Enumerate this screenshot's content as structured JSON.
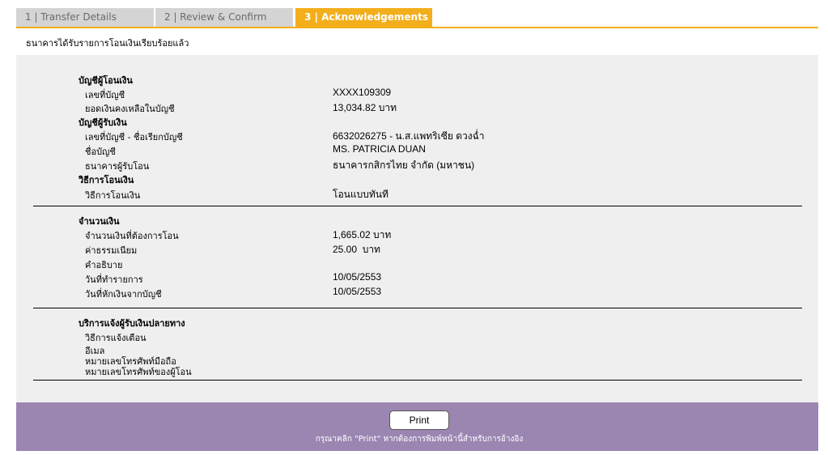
{
  "tabs": [
    {
      "label": "1 | Transfer Details"
    },
    {
      "label": "2 | Review & Confirm"
    },
    {
      "label": "3 | Acknowledgements"
    }
  ],
  "status_message": "ธนาคารได้รับรายการโอนเงินเรียบร้อยแล้ว",
  "from_account": {
    "heading": "บัญชีผู้โอนเงิน",
    "account_no_label": "เลขที่บัญชี",
    "account_no": "XXXX109309",
    "balance_label": "ยอดเงินคงเหลือในบัญชี",
    "balance": "13,034.82 บาท"
  },
  "to_account": {
    "heading": "บัญชีผู้รับเงิน",
    "account_label": "เลขที่บัญชี - ชื่อเรียกบัญชี",
    "account": "6632026275 - น.ส.แพทริเซีย ดวงฉ่ำ",
    "name_label": "ชื่อบัญชี",
    "name": "MS. PATRICIA DUAN",
    "bank_label": "ธนาคารผู้รับโอน",
    "bank": "ธนาคารกสิกรไทย จำกัด (มหาชน)"
  },
  "method": {
    "heading": "วิธีการโอนเงิน",
    "label": "วิธีการโอนเงิน",
    "value": "โอนแบบทันที"
  },
  "amount": {
    "heading": "จำนวนเงิน",
    "amount_label": "จำนวนเงินที่ต้องการโอน",
    "amount": "1,665.02 บาท",
    "fee_label": "ค่าธรรมเนียม",
    "fee": "25.00  บาท",
    "desc_label": "คำอธิบาย",
    "txn_date_label": "วันที่ทำรายการ",
    "txn_date": "10/05/2553",
    "debit_date_label": "วันที่หักเงินจากบัญชี",
    "debit_date": "10/05/2553"
  },
  "notify": {
    "heading": "บริการแจ้งผู้รับเงินปลายทาง",
    "method_label": "วิธีการแจ้งเตือน",
    "email_label": "อีเมล",
    "mobile_label": "หมายเลขโทรศัพท์มือถือ",
    "sender_phone_label": "หมายเลขโทรศัพท์ของผู้โอน"
  },
  "footer": {
    "print_label": "Print",
    "note": "กรุณาคลิก \"Print\" หากต้องการพิมพ์หน้านี้สำหรับการอ้างอิง"
  },
  "colors": {
    "accent": "#f3ae1c",
    "inactive_tab": "#d4d4d4",
    "panel": "#f0efef",
    "footer": "#9b86b2"
  }
}
